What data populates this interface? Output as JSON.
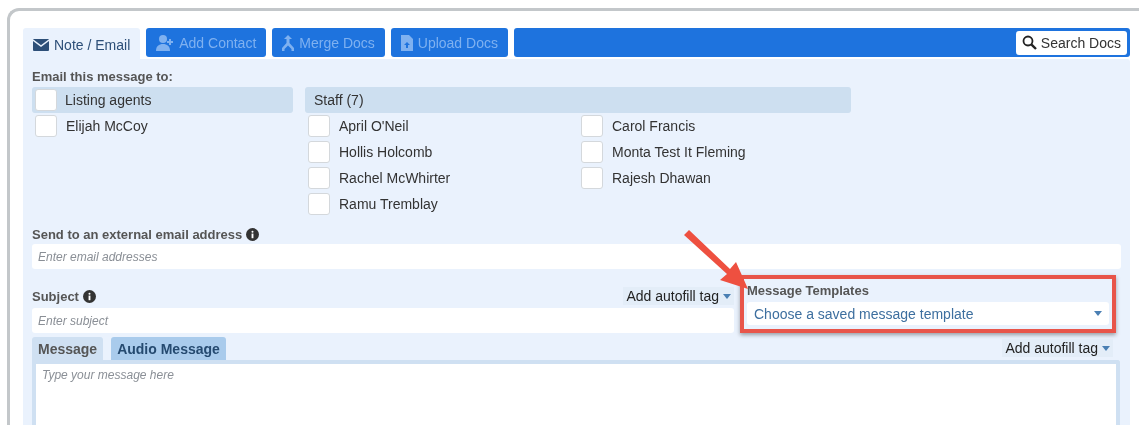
{
  "top_tabs": [
    {
      "label": "Note / Email",
      "selected": true
    },
    {
      "label": "Add Contact",
      "selected": false
    },
    {
      "label": "Merge Docs",
      "selected": false
    },
    {
      "label": "Upload Docs",
      "selected": false
    }
  ],
  "search_button": {
    "label": "Search Docs"
  },
  "recipients": {
    "title": "Email this message to:",
    "groups": [
      {
        "name": "Listing agents",
        "checked": false,
        "columns": [
          [
            {
              "name": "Elijah McCoy",
              "checked": false
            }
          ]
        ]
      },
      {
        "name": "Staff (7)",
        "columns": [
          [
            {
              "name": "April O'Neil",
              "checked": false
            },
            {
              "name": "Hollis Holcomb",
              "checked": false
            },
            {
              "name": "Rachel McWhirter",
              "checked": false
            },
            {
              "name": "Ramu Tremblay",
              "checked": false
            }
          ],
          [
            {
              "name": "Carol Francis",
              "checked": false
            },
            {
              "name": "Monta Test It Fleming",
              "checked": false
            },
            {
              "name": "Rajesh Dhawan",
              "checked": false
            }
          ]
        ]
      }
    ]
  },
  "external": {
    "label": "Send to an external email address",
    "placeholder": "Enter email addresses"
  },
  "subject": {
    "label": "Subject",
    "placeholder": "Enter subject",
    "autofill": "Add autofill tag"
  },
  "templates": {
    "label": "Message Templates",
    "placeholder": "Choose a saved message template",
    "highlighted": true
  },
  "message_tabs": [
    {
      "label": "Message",
      "selected": true
    },
    {
      "label": "Audio Message",
      "selected": false
    }
  ],
  "message": {
    "autofill": "Add autofill tag",
    "placeholder": "Type your message here"
  }
}
